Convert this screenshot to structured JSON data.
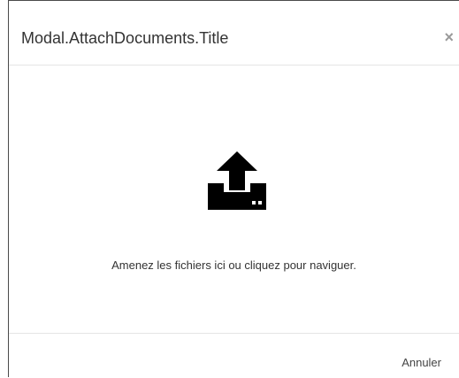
{
  "modal": {
    "title": "Modal.AttachDocuments.Title",
    "close_label": "×",
    "dropzone": {
      "icon": "upload-icon",
      "instruction": "Amenez les fichiers ici ou cliquez pour naviguer."
    },
    "footer": {
      "cancel_label": "Annuler"
    }
  },
  "colors": {
    "title_text": "#333333",
    "close_icon": "#9a9a9a",
    "divider": "#e5e5e5",
    "icon": "#000000"
  }
}
